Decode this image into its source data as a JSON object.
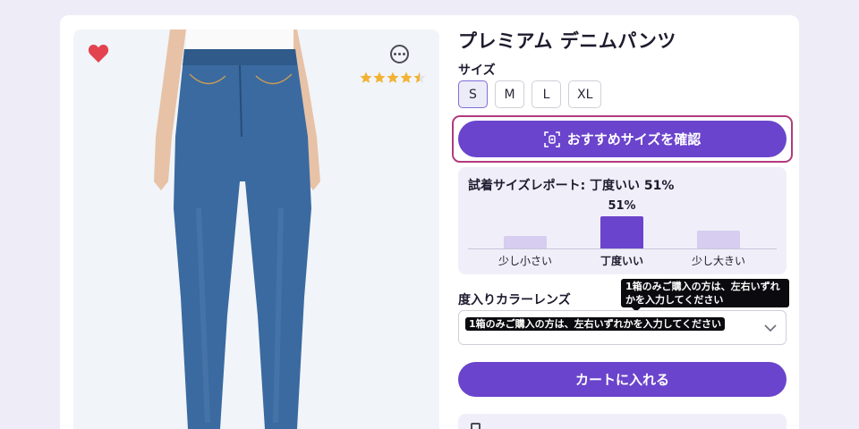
{
  "product": {
    "title": "プレミアム デニムパンツ",
    "rating": 4.5
  },
  "size": {
    "label": "サイズ",
    "options": [
      "S",
      "M",
      "L",
      "XL"
    ],
    "selected": "S"
  },
  "recommend_button": {
    "label": "おすすめサイズを確認",
    "icon": "scan-icon"
  },
  "fit_report": {
    "title": "試着サイズレポート: 丁度いい 51%",
    "top_value_label": "51%",
    "bars": [
      {
        "label": "少し小さい",
        "value": 0.2
      },
      {
        "label": "丁度いい",
        "value": 0.51
      },
      {
        "label": "少し大きい",
        "value": 0.29
      }
    ]
  },
  "lens": {
    "label": "度入りカラーレンズ",
    "tooltip": "1箱のみご購入の方は、左右いずれかを入力してください",
    "field_tooltip": "1箱のみご購入の方は、左右いずれかを入力してください"
  },
  "cart_button": {
    "label": "カートに入れる"
  },
  "colors": {
    "accent": "#6a44cc",
    "highlight_outline": "#b23a7c",
    "bar_main": "#6a44cc",
    "bar_light": "#d6cdf0",
    "heart": "#e2434e",
    "star": "#f2b233"
  }
}
